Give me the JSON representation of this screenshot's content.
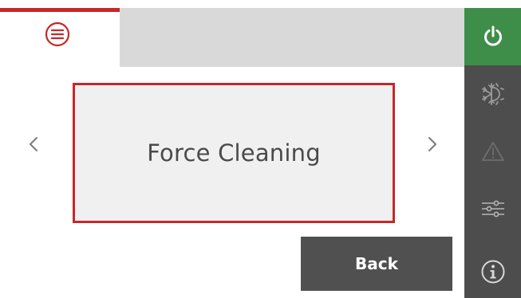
{
  "colors": {
    "accent_red": "#c62828",
    "header_gray": "#d9d9d9",
    "sidebar_dark": "#4d4d4d",
    "power_green": "#3e8e4a",
    "card_bg": "#f0f0f0",
    "back_button_bg": "#505050",
    "arrow_gray": "#7a7a7a",
    "icon_light": "#ffffff",
    "icon_dim": "#6a6a6a"
  },
  "top_bar": {
    "menu_icon": "menu-lines-circle-icon"
  },
  "sidebar": {
    "items": [
      {
        "name": "power",
        "icon": "power-icon",
        "active": true
      },
      {
        "name": "mode",
        "icon": "sun-snowflake-icon",
        "active": false
      },
      {
        "name": "alerts",
        "icon": "warning-triangle-icon",
        "active": false
      },
      {
        "name": "settings",
        "icon": "sliders-icon",
        "active": false
      },
      {
        "name": "info",
        "icon": "info-icon",
        "active": false
      }
    ]
  },
  "main": {
    "card_label": "Force Cleaning",
    "prev_icon": "chevron-left-icon",
    "next_icon": "chevron-right-icon"
  },
  "footer": {
    "back_label": "Back"
  }
}
